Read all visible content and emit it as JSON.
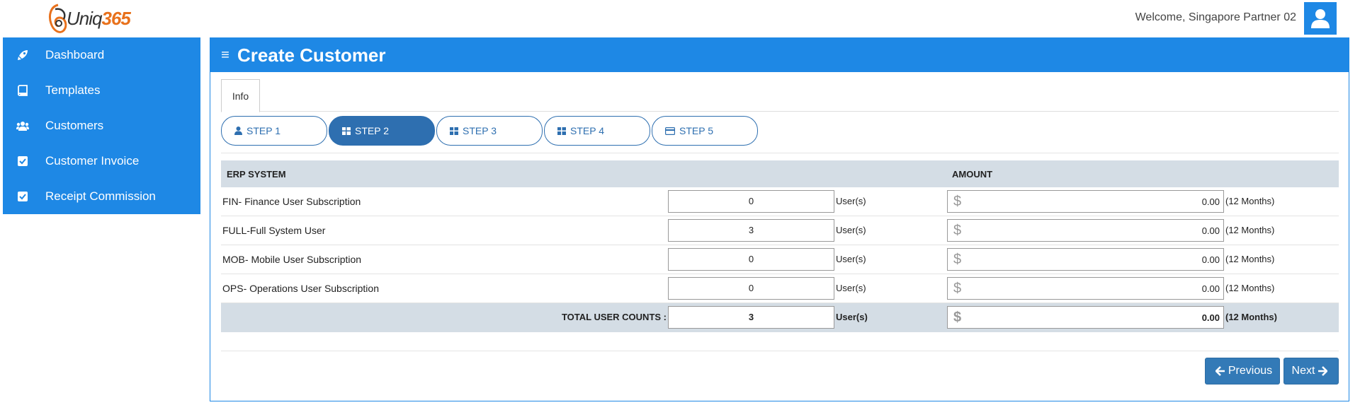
{
  "header": {
    "logo_text_main": "Uniq",
    "logo_text_num": "365",
    "welcome": "Welcome, Singapore Partner 02"
  },
  "sidebar": {
    "items": [
      {
        "label": "Dashboard",
        "icon": "rocket-icon"
      },
      {
        "label": "Templates",
        "icon": "book-icon"
      },
      {
        "label": "Customers",
        "icon": "users-icon"
      },
      {
        "label": "Customer Invoice",
        "icon": "checkbox-icon"
      },
      {
        "label": "Receipt Commission",
        "icon": "checkbox-icon"
      }
    ]
  },
  "main": {
    "title": "Create Customer",
    "tab": "Info",
    "steps": [
      {
        "label": "STEP 1",
        "icon": "user-icon",
        "active": false
      },
      {
        "label": "STEP 2",
        "icon": "grid-icon",
        "active": true
      },
      {
        "label": "STEP 3",
        "icon": "grid-icon",
        "active": false
      },
      {
        "label": "STEP 4",
        "icon": "grid-icon",
        "active": false
      },
      {
        "label": "STEP 5",
        "icon": "credit-card-icon",
        "active": false
      }
    ]
  },
  "table": {
    "col_erp": "ERP SYSTEM",
    "col_amount": "AMOUNT",
    "unit_label": "User(s)",
    "currency": "$",
    "period_label": "(12 Months)",
    "rows": [
      {
        "name": "FIN- Finance User Subscription",
        "qty": "0",
        "amount": "0.00"
      },
      {
        "name": "FULL-Full System User",
        "qty": "3",
        "amount": "0.00"
      },
      {
        "name": "MOB- Mobile User Subscription",
        "qty": "0",
        "amount": "0.00"
      },
      {
        "name": "OPS- Operations User Subscription",
        "qty": "0",
        "amount": "0.00"
      }
    ],
    "total": {
      "label": "TOTAL USER COUNTS :",
      "qty": "3",
      "amount": "0.00"
    }
  },
  "buttons": {
    "previous": "Previous",
    "next": "Next"
  },
  "colors": {
    "primary": "#1e88e5",
    "step_active": "#2e6fb0",
    "table_head": "#d4dde5",
    "logo_accent": "#e8711c"
  }
}
